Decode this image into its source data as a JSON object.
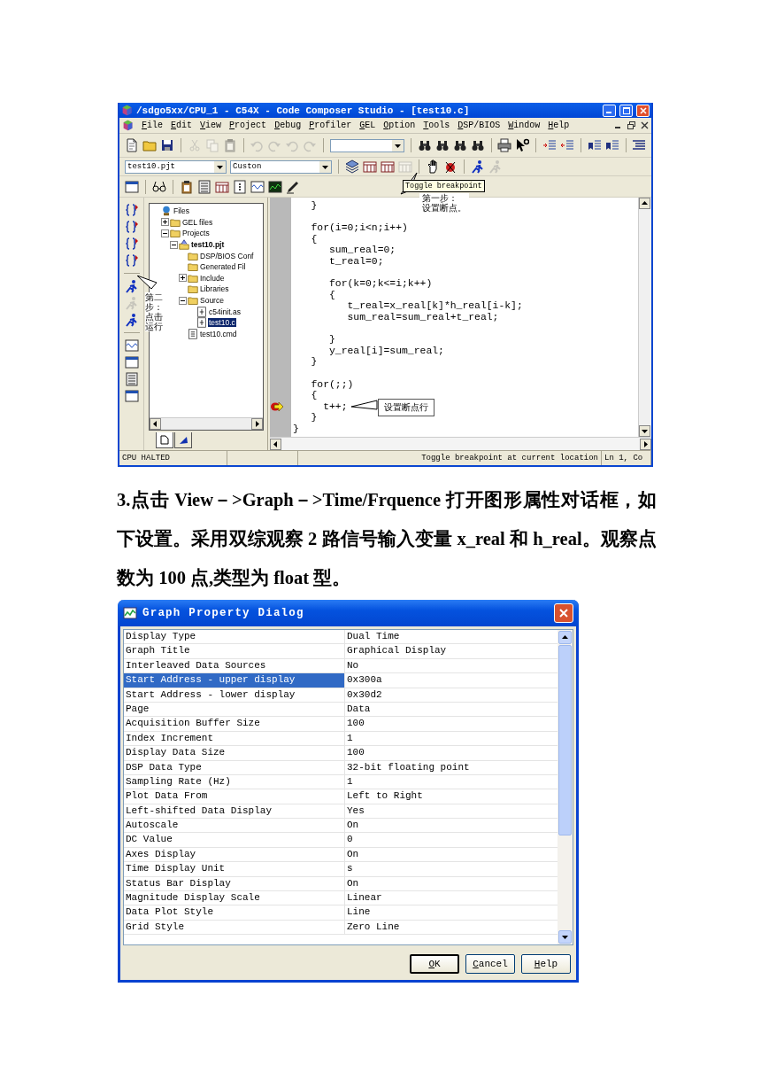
{
  "ide": {
    "title": "/sdgo5xx/CPU_1 - C54X - Code Composer Studio - [test10.c]",
    "menu": [
      "File",
      "Edit",
      "View",
      "Project",
      "Debug",
      "Profiler",
      "GEL",
      "Option",
      "Tools",
      "DSP/BIOS",
      "Window",
      "Help"
    ],
    "toolbars": [
      [
        {
          "kind": "page",
          "disabled": false
        },
        {
          "kind": "folder",
          "disabled": false
        },
        {
          "kind": "floppy",
          "disabled": false
        },
        {
          "kind": "sep"
        },
        {
          "kind": "scissors",
          "disabled": true
        },
        {
          "kind": "copy",
          "disabled": true
        },
        {
          "kind": "clipboard",
          "disabled": true
        },
        {
          "kind": "sep"
        },
        {
          "kind": "undo",
          "disabled": true
        },
        {
          "kind": "redo",
          "disabled": true
        },
        {
          "kind": "undo",
          "disabled": true
        },
        {
          "kind": "redo",
          "disabled": true
        },
        {
          "kind": "sep"
        },
        {
          "kind": "combo"
        },
        {
          "kind": "sep"
        },
        {
          "kind": "binoculars",
          "disabled": false
        },
        {
          "kind": "binoculars",
          "disabled": false
        },
        {
          "kind": "binoculars",
          "disabled": false
        },
        {
          "kind": "binoculars",
          "disabled": false
        },
        {
          "kind": "sep"
        },
        {
          "kind": "printer",
          "disabled": false
        },
        {
          "kind": "help",
          "disabled": false
        },
        {
          "kind": "sep"
        },
        {
          "kind": "indent",
          "disabled": false
        },
        {
          "kind": "outdent",
          "disabled": false
        },
        {
          "kind": "sep"
        },
        {
          "kind": "bookmark",
          "disabled": false
        },
        {
          "kind": "bookmark",
          "disabled": false
        },
        {
          "kind": "sep"
        },
        {
          "kind": "list",
          "disabled": false
        }
      ],
      [
        {
          "kind": "combo",
          "value": "test10.pjt"
        },
        {
          "kind": "combo",
          "value": "Custon"
        },
        {
          "kind": "sep"
        },
        {
          "kind": "stack",
          "disabled": false
        },
        {
          "kind": "grid",
          "disabled": false
        },
        {
          "kind": "grid",
          "disabled": false
        },
        {
          "kind": "grid",
          "disabled": true
        },
        {
          "kind": "sep"
        },
        {
          "kind": "hand",
          "disabled": false
        },
        {
          "kind": "bug",
          "disabled": false
        },
        {
          "kind": "sep"
        },
        {
          "kind": "runner",
          "disabled": false
        },
        {
          "kind": "runner",
          "disabled": true
        }
      ],
      [
        {
          "kind": "window",
          "disabled": false
        },
        {
          "kind": "sep"
        },
        {
          "kind": "glasses",
          "disabled": false
        },
        {
          "kind": "sep"
        },
        {
          "kind": "clipboard",
          "disabled": false
        },
        {
          "kind": "calc",
          "disabled": false
        },
        {
          "kind": "grid",
          "disabled": false
        },
        {
          "kind": "dots",
          "disabled": false
        },
        {
          "kind": "wave",
          "disabled": false
        },
        {
          "kind": "chart",
          "disabled": false
        },
        {
          "kind": "pen",
          "disabled": false
        }
      ]
    ],
    "side_toolbar": [
      {
        "kind": "brace",
        "disabled": false
      },
      {
        "kind": "brace",
        "disabled": false
      },
      {
        "kind": "brace",
        "disabled": false
      },
      {
        "kind": "brace",
        "disabled": false
      },
      {
        "kind": "sep"
      },
      {
        "kind": "runner",
        "disabled": false
      },
      {
        "kind": "runner",
        "disabled": true
      },
      {
        "kind": "runner",
        "disabled": false
      },
      {
        "kind": "sep"
      },
      {
        "kind": "wave",
        "disabled": false
      },
      {
        "kind": "window",
        "disabled": false
      },
      {
        "kind": "calc",
        "disabled": false
      },
      {
        "kind": "window",
        "disabled": false
      }
    ],
    "tree": {
      "label": "Files",
      "kind": "root",
      "selected": false,
      "children": [
        {
          "label": "GEL files",
          "kind": "folder",
          "expanded": false,
          "selected": false
        },
        {
          "label": "Projects",
          "kind": "folder",
          "expanded": true,
          "selected": false,
          "children": [
            {
              "label": "test10.pjt",
              "kind": "project",
              "expanded": true,
              "selected": false,
              "children": [
                {
                  "label": "DSP/BIOS Conf",
                  "kind": "folder",
                  "selected": false
                },
                {
                  "label": "Generated Fil",
                  "kind": "folder",
                  "selected": false
                },
                {
                  "label": "Include",
                  "kind": "folder",
                  "expanded": false,
                  "selected": false
                },
                {
                  "label": "Libraries",
                  "kind": "folder",
                  "selected": false
                },
                {
                  "label": "Source",
                  "kind": "folder",
                  "expanded": true,
                  "selected": false,
                  "children": [
                    {
                      "label": "c54init.as",
                      "kind": "source",
                      "selected": false
                    },
                    {
                      "label": "test10.c",
                      "kind": "source",
                      "selected": true
                    }
                  ]
                },
                {
                  "label": "test10.cmd",
                  "kind": "doc",
                  "selected": false
                }
              ]
            }
          ]
        }
      ]
    },
    "code_lines": [
      {
        "kind": "code",
        "text": "   }",
        "marker": false
      },
      {
        "kind": "blank"
      },
      {
        "kind": "code",
        "text": "   for(i=0;i<n;i++)",
        "marker": false
      },
      {
        "kind": "code",
        "text": "   {",
        "marker": false
      },
      {
        "kind": "code",
        "text": "      sum_real=0;",
        "marker": false
      },
      {
        "kind": "code",
        "text": "      t_real=0;",
        "marker": false
      },
      {
        "kind": "blank"
      },
      {
        "kind": "code",
        "text": "      for(k=0;k<=i;k++)",
        "marker": false
      },
      {
        "kind": "code",
        "text": "      {",
        "marker": false
      },
      {
        "kind": "code",
        "text": "         t_real=x_real[k]*h_real[i-k];",
        "marker": false
      },
      {
        "kind": "code",
        "text": "         sum_real=sum_real+t_real;",
        "marker": false
      },
      {
        "kind": "blank"
      },
      {
        "kind": "code",
        "text": "      }",
        "marker": false
      },
      {
        "kind": "code",
        "text": "      y_real[i]=sum_real;",
        "marker": false
      },
      {
        "kind": "code",
        "text": "   }",
        "marker": false
      },
      {
        "kind": "blank"
      },
      {
        "kind": "code",
        "text": "   for(;;)",
        "marker": false
      },
      {
        "kind": "code",
        "text": "   {",
        "marker": false
      },
      {
        "kind": "code",
        "text": "     t++;",
        "marker": true
      },
      {
        "kind": "code",
        "text": "   }",
        "marker": false
      },
      {
        "kind": "code",
        "text": "}",
        "marker": false
      }
    ],
    "status_bar": {
      "state": "CPU HALTED",
      "message": "Toggle breakpoint at current location",
      "position": "Ln 1, Co"
    },
    "annotations": [
      {
        "kind": "tooltip",
        "text": "Toggle breakpoint"
      },
      {
        "kind": "note",
        "lines": [
          "第一步：",
          "设置断点。"
        ]
      },
      {
        "kind": "vertical-note",
        "text": "第二步：点击运行"
      },
      {
        "kind": "boxed-note",
        "text": "设置断点行"
      }
    ]
  },
  "paragraph": "3.点击 View－>Graph－>Time/Frquence 打开图形属性对话框，如下设置。采用双综观察 2 路信号输入变量 x_real  和 h_real。观察点数为 100 点,类型为 float 型。",
  "dialog": {
    "title": "Graph Property Dialog",
    "properties": [
      {
        "name": "Display Type",
        "value": "Dual Time",
        "selected": false
      },
      {
        "name": "Graph Title",
        "value": "Graphical Display",
        "selected": false
      },
      {
        "name": "Interleaved Data Sources",
        "value": "No",
        "selected": false
      },
      {
        "name": "Start Address - upper display",
        "value": "0x300a",
        "selected": true
      },
      {
        "name": "Start Address - lower display",
        "value": "0x30d2",
        "selected": false
      },
      {
        "name": "Page",
        "value": "Data",
        "selected": false
      },
      {
        "name": "Acquisition Buffer Size",
        "value": "100",
        "selected": false
      },
      {
        "name": "Index Increment",
        "value": "1",
        "selected": false
      },
      {
        "name": "Display Data Size",
        "value": "100",
        "selected": false
      },
      {
        "name": "DSP Data Type",
        "value": "32-bit floating point",
        "selected": false
      },
      {
        "name": "Sampling Rate (Hz)",
        "value": "1",
        "selected": false
      },
      {
        "name": "Plot Data From",
        "value": "Left to Right",
        "selected": false
      },
      {
        "name": "Left-shifted Data Display",
        "value": "Yes",
        "selected": false
      },
      {
        "name": "Autoscale",
        "value": "On",
        "selected": false
      },
      {
        "name": "DC Value",
        "value": "0",
        "selected": false
      },
      {
        "name": "Axes Display",
        "value": "On",
        "selected": false
      },
      {
        "name": "Time Display Unit",
        "value": "s",
        "selected": false
      },
      {
        "name": "Status Bar Display",
        "value": "On",
        "selected": false
      },
      {
        "name": "Magnitude Display Scale",
        "value": "Linear",
        "selected": false
      },
      {
        "name": "Data Plot Style",
        "value": "Line",
        "selected": false
      },
      {
        "name": "Grid Style",
        "value": "Zero Line",
        "selected": false
      }
    ],
    "buttons": [
      {
        "label": "OK",
        "default": true
      },
      {
        "label": "Cancel",
        "default": false
      },
      {
        "label": "Help",
        "default": false
      }
    ]
  }
}
